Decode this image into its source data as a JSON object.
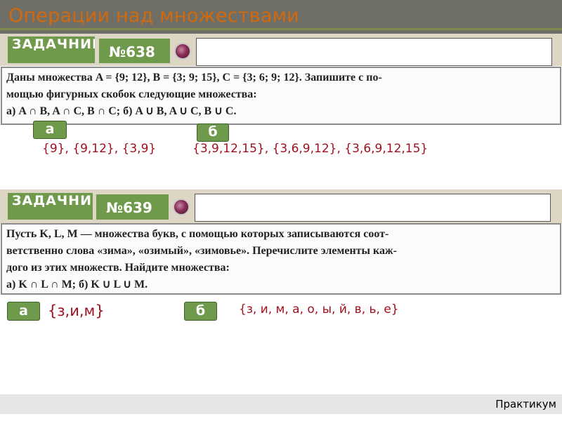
{
  "header": {
    "title": "Операции над множествами"
  },
  "task638": {
    "book_label": "ЗАДАЧНИК",
    "number": "№638",
    "lines": [
      "Даны  множества  A = {9; 12},   B = {3; 9; 15},   C = {3; 6; 9; 12}.  Запишите  с  по-",
      "мощью фигурных скобок следующие множества:",
      "а) A ∩ B,  A ∩ C,  B ∩ C;          б) A ∪ B,  A ∪ C,  B ∪ C."
    ],
    "tag_a": "а",
    "tag_b": "б",
    "answer_a": "{9}, {9,12}, {3,9}",
    "answer_b": "{3,9,12,15}, {3,6,9,12}, {3,6,9,12,15}"
  },
  "task639": {
    "book_label": "ЗАДАЧНИК",
    "number": "№639",
    "lines": [
      "Пусть  K,  L,  M — множества букв,  с помощью которых записываются  соот-",
      "ветственно слова «зима», «озимый», «зимовье». Перечислите элементы каж-",
      "дого из этих множеств.  Найдите множества:",
      "а) K ∩ L ∩ M;         б) K ∪ L ∪ M."
    ],
    "tag_a": "а",
    "tag_b": "б",
    "answer_a": "{з,и,м}",
    "answer_b": "{з, и, м, а, о, ы, й, в, ь, е}"
  },
  "footer": {
    "label": "Практикум"
  }
}
